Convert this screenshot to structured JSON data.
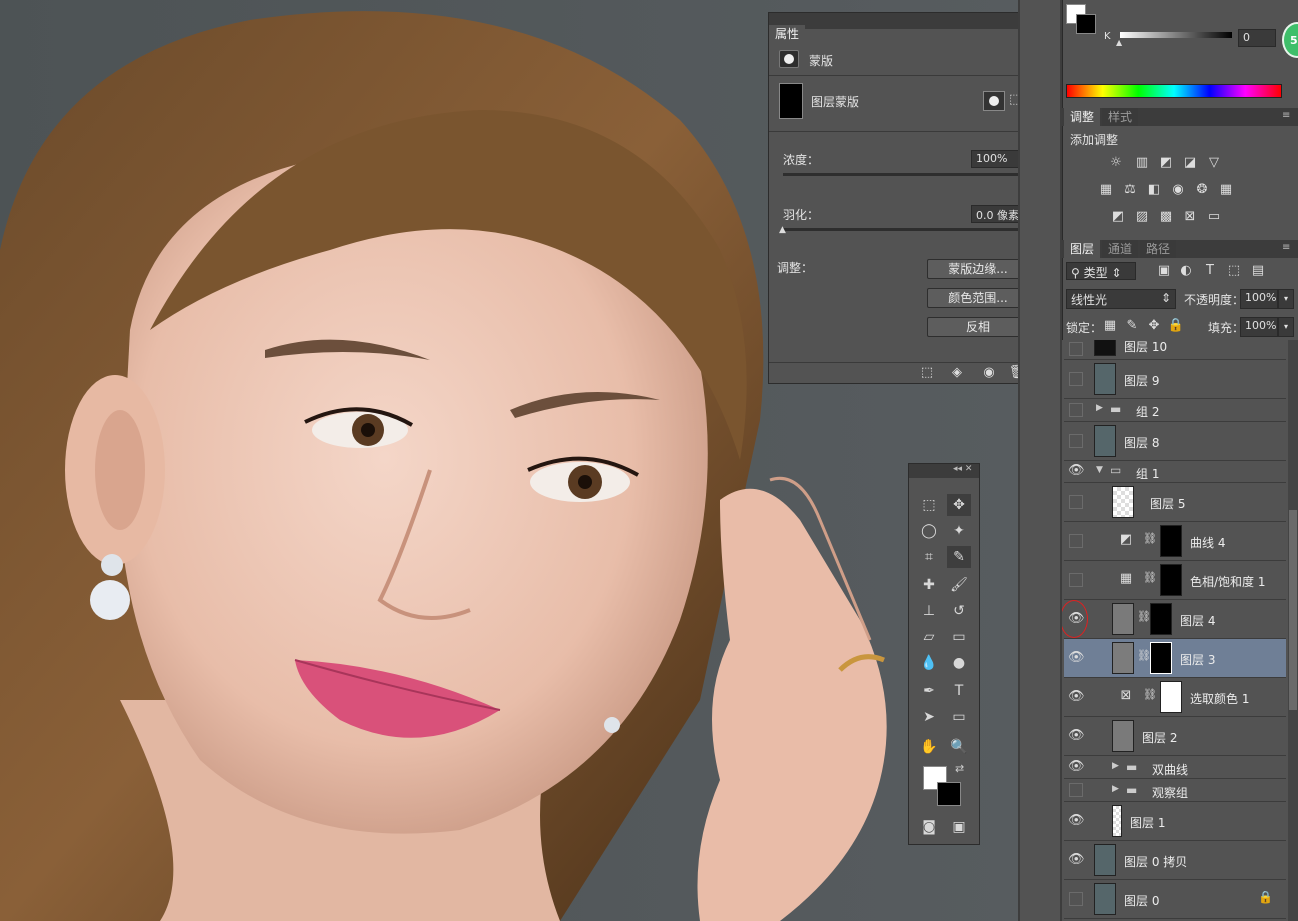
{
  "properties_panel": {
    "tab": "属性",
    "section": "蒙版",
    "mask_label": "图层蒙版",
    "density_label": "浓度：",
    "density_value": "100%",
    "feather_label": "羽化：",
    "feather_value": "0.0 像素",
    "adjust_label": "调整：",
    "mask_edge_button": "蒙版边缘...",
    "color_range_button": "颜色范围...",
    "invert_button": "反相"
  },
  "color_panel": {
    "k_label": "K",
    "k_value": "0",
    "badge": "56"
  },
  "adjustments_panel": {
    "tabs": [
      "调整",
      "样式"
    ],
    "title": "添加调整"
  },
  "layers_panel": {
    "tabs": [
      "图层",
      "通道",
      "路径"
    ],
    "filter_label": "类型",
    "blend_mode": "线性光",
    "opacity_label": "不透明度：",
    "opacity_value": "100%",
    "lock_label": "锁定：",
    "fill_label": "填充：",
    "fill_value": "100%",
    "layers": [
      {
        "name": "图层 10"
      },
      {
        "name": "图层 9"
      },
      {
        "name": "组 2"
      },
      {
        "name": "图层 8"
      },
      {
        "name": "组 1"
      },
      {
        "name": "图层 5"
      },
      {
        "name": "曲线 4"
      },
      {
        "name": "色相/饱和度 1"
      },
      {
        "name": "图层 4"
      },
      {
        "name": "图层 3"
      },
      {
        "name": "选取颜色 1"
      },
      {
        "name": "图层 2"
      },
      {
        "name": "双曲线"
      },
      {
        "name": "观察组"
      },
      {
        "name": "图层 1"
      },
      {
        "name": "图层 0 拷贝"
      },
      {
        "name": "图层 0"
      }
    ]
  },
  "colors": {
    "panel": "#535353",
    "selected_row": "#6f7f96",
    "highlight_circle": "#e02020",
    "badge_green": "#3fbf6a"
  }
}
